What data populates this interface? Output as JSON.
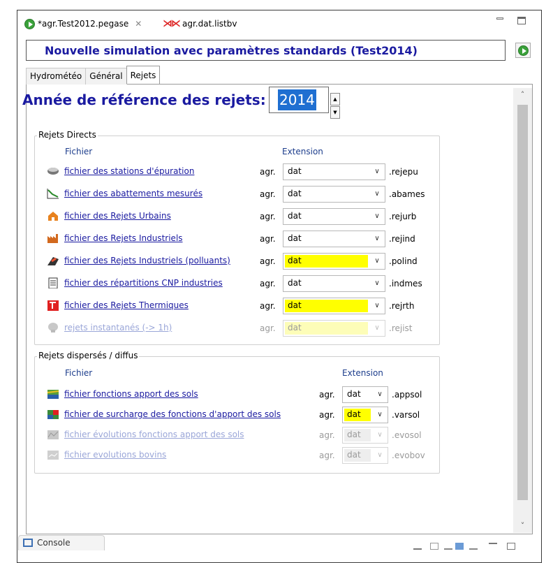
{
  "editor_tabs": [
    {
      "label": "*agr.Test2012.pegase",
      "close": "✕"
    },
    {
      "label": "agr.dat.listbv"
    }
  ],
  "title": "Nouvelle simulation avec paramètres standards (Test2014)",
  "sub_tabs": [
    "Hydrométéo",
    "Général",
    "Rejets"
  ],
  "active_sub_tab": "Rejets",
  "year": {
    "label": "Année de référence des rejets:",
    "value": "2014"
  },
  "rejets_directs": {
    "title": "Rejets Directs",
    "col_file": "Fichier",
    "col_ext": "Extension",
    "rows": [
      {
        "icon": "treatment-plant-icon",
        "label": "fichier des stations d'épuration",
        "agr": "agr.",
        "value": "dat",
        "ext": ".rejepu",
        "state": "normal"
      },
      {
        "icon": "chart-decline-icon",
        "label": "fichier des abattements mesurés",
        "agr": "agr.",
        "value": "dat",
        "ext": ".abames",
        "state": "normal"
      },
      {
        "icon": "house-icon",
        "label": "fichier des Rejets Urbains",
        "agr": "agr.",
        "value": "dat",
        "ext": ".rejurb",
        "state": "normal"
      },
      {
        "icon": "factory-icon",
        "label": "fichier des Rejets Industriels",
        "agr": "agr.",
        "value": "dat",
        "ext": ".rejind",
        "state": "normal"
      },
      {
        "icon": "pollutant-icon",
        "label": "fichier des Rejets Industriels (polluants)",
        "agr": "agr.",
        "value": "dat",
        "ext": ".polind",
        "state": "yellow"
      },
      {
        "icon": "document-icon",
        "label": "fichier des répartitions CNP industries",
        "agr": "agr.",
        "value": "dat",
        "ext": ".indmes",
        "state": "normal"
      },
      {
        "icon": "thermal-icon",
        "label": "fichier des Rejets Thermiques",
        "agr": "agr.",
        "value": "dat",
        "ext": ".rejrth",
        "state": "yellow"
      },
      {
        "icon": "instant-icon",
        "label": "rejets instantanés (-> 1h)",
        "agr": "agr.",
        "value": "dat",
        "ext": ".rejist",
        "state": "disabled-yellow"
      }
    ]
  },
  "rejets_diffus": {
    "title": "Rejets dispersés / diffus",
    "col_file": "Fichier",
    "col_ext": "Extension",
    "rows": [
      {
        "icon": "soil-icon",
        "label": "fichier fonctions apport des sols",
        "agr": "agr.",
        "value": "dat",
        "ext": ".appsol",
        "state": "normal"
      },
      {
        "icon": "soil-overload-icon",
        "label": "fichier de surcharge des fonctions d'apport des sols",
        "agr": "agr.",
        "value": "dat",
        "ext": ".varsol",
        "state": "yellow"
      },
      {
        "icon": "soil-evolution-icon",
        "label": "fichier évolutions fonctions apport des sols",
        "agr": "agr.",
        "value": "dat",
        "ext": ".evosol",
        "state": "disabled-gray"
      },
      {
        "icon": "bovine-evolution-icon",
        "label": "fichier evolutions bovins",
        "agr": "agr.",
        "value": "dat",
        "ext": ".evobov",
        "state": "disabled-gray"
      }
    ]
  },
  "console_tab": "Console",
  "colors": {
    "title_blue": "#1a1aa0",
    "highlight_yellow": "#ffff00",
    "selection_blue": "#1f6fd1"
  }
}
